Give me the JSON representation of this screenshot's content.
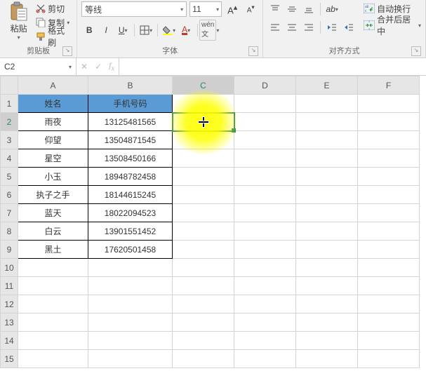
{
  "ribbon": {
    "clipboard": {
      "paste": "粘贴",
      "cut": "剪切",
      "copy": "复制",
      "format_painter": "格式刷",
      "title": "剪贴板"
    },
    "font": {
      "name": "等线",
      "size": "11",
      "title": "字体"
    },
    "align": {
      "wrap": "自动换行",
      "merge": "合并后居中",
      "title": "对齐方式"
    }
  },
  "cell_ref": "C2",
  "columns": [
    "A",
    "B",
    "C",
    "D",
    "E",
    "F"
  ],
  "row_count": 15,
  "table": {
    "headers": [
      "姓名",
      "手机号码"
    ],
    "rows": [
      {
        "name": "雨夜",
        "phone": "13125481565"
      },
      {
        "name": "仰望",
        "phone": "13504871545"
      },
      {
        "name": "星空",
        "phone": "13508450166"
      },
      {
        "name": "小玉",
        "phone": "18948782458"
      },
      {
        "name": "执子之手",
        "phone": "18144615245"
      },
      {
        "name": "蓝天",
        "phone": "18022094523"
      },
      {
        "name": "白云",
        "phone": "13901551452"
      },
      {
        "name": "黑土",
        "phone": "17620501458"
      }
    ]
  },
  "active": {
    "col": "C",
    "row": 2
  },
  "chart_data": {
    "type": "table",
    "title": "",
    "columns": [
      "姓名",
      "手机号码"
    ],
    "rows": [
      [
        "雨夜",
        "13125481565"
      ],
      [
        "仰望",
        "13504871545"
      ],
      [
        "星空",
        "13508450166"
      ],
      [
        "小玉",
        "18948782458"
      ],
      [
        "执子之手",
        "18144615245"
      ],
      [
        "蓝天",
        "18022094523"
      ],
      [
        "白云",
        "13901551452"
      ],
      [
        "黑土",
        "17620501458"
      ]
    ]
  }
}
